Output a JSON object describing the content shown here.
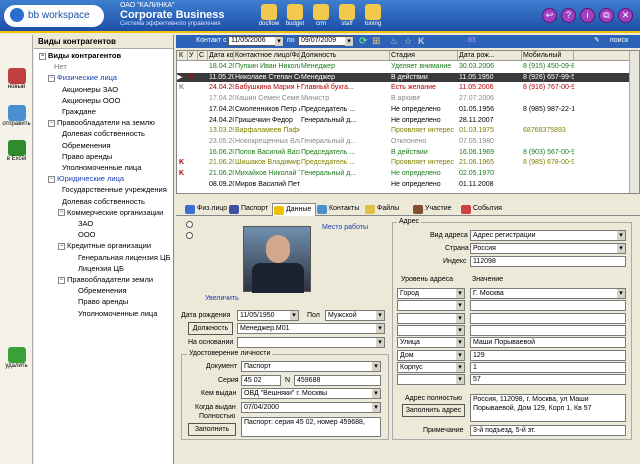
{
  "header": {
    "logo": "bb workspace",
    "company_small": "ОАО \"КАЛИНКА\"",
    "company": "Corporate Business",
    "subtitle": "Система эффективного управления",
    "toolbar": [
      {
        "label": "docflow",
        "icon": "docflow-icon"
      },
      {
        "label": "budget",
        "icon": "budget-icon"
      },
      {
        "label": "crm",
        "icon": "crm-icon"
      },
      {
        "label": "staff",
        "icon": "staff-icon"
      },
      {
        "label": "tuning",
        "icon": "tuning-icon"
      }
    ],
    "window_buttons": [
      "↩",
      "?",
      "i",
      "⧉",
      "✕"
    ]
  },
  "left_bar": [
    {
      "label": "новый",
      "icon": "new-icon"
    },
    {
      "label": "отправить",
      "icon": "send-icon"
    },
    {
      "label": "в Excel",
      "icon": "excel-icon"
    },
    {
      "label": "удалить",
      "icon": "delete-icon"
    }
  ],
  "tree": {
    "title": "Виды контрагентов",
    "nodes": [
      {
        "t": "Виды контрагентов",
        "s": "b"
      },
      {
        "t": "Нет",
        "s": "g"
      },
      {
        "t": "Физические лица",
        "s": "bl"
      },
      {
        "t": "Акционеры ЗАО",
        "s": ""
      },
      {
        "t": "Акционеры ООО",
        "s": ""
      },
      {
        "t": "Граждане",
        "s": ""
      },
      {
        "t": "Правообладатели на землю",
        "s": ""
      },
      {
        "t": "Долевая собственность",
        "s": ""
      },
      {
        "t": "Обременения",
        "s": ""
      },
      {
        "t": "Право аренды",
        "s": ""
      },
      {
        "t": "Уполномоченные лица",
        "s": ""
      },
      {
        "t": "Юридические лица",
        "s": "bl"
      },
      {
        "t": "Государственные учреждения",
        "s": ""
      },
      {
        "t": "Долевая собственность",
        "s": ""
      },
      {
        "t": "Коммерческие организации",
        "s": ""
      },
      {
        "t": "ЗАО",
        "s": ""
      },
      {
        "t": "ООО",
        "s": ""
      },
      {
        "t": "Кредитные организации",
        "s": ""
      },
      {
        "t": "Генеральная лицензия ЦБ",
        "s": ""
      },
      {
        "t": "Лицензия ЦБ",
        "s": ""
      },
      {
        "t": "Правообладатели земли",
        "s": ""
      },
      {
        "t": "Обременения",
        "s": ""
      },
      {
        "t": "Право аренды",
        "s": ""
      },
      {
        "t": "Уполномоченные лица",
        "s": ""
      }
    ]
  },
  "filter": {
    "contact_label": "Контакт с",
    "date_from": "11/05/2006",
    "to_label": "по",
    "date_to": "09/07/2009",
    "count": "83",
    "search": "поиск"
  },
  "grid": {
    "columns": [
      "К",
      "У",
      "С",
      "Дата конт...",
      "Контактное лицо/Фамилия ...",
      "Должность",
      "Стадия",
      "Дата рож...",
      "Мобильный"
    ],
    "rows": [
      {
        "k": "",
        "date": "18.04.2008",
        "name": "Пупкин Иван Николаевич",
        "pos": "Менеджер",
        "stage": "Уделяет внимание",
        "bd": "30.03.2006",
        "mob": "8 (915) 450-09-88",
        "c": "#1a7a1a"
      },
      {
        "k": "K",
        "date": "11.05.2006",
        "name": "Николаев Степан Семенович",
        "pos": "Менеджер",
        "stage": "В действии",
        "bd": "11.05.1950",
        "mob": "8 (926) 657-99-56",
        "c": "#fff",
        "sel": "1"
      },
      {
        "k": "K",
        "date": "24.04.2008",
        "name": "Бабушкина Мария Николаевна",
        "pos": "Главный бухга...",
        "stage": "Есть желание",
        "bd": "11.05.2006",
        "mob": "8 (916) 767-00-99",
        "c": "#b00000"
      },
      {
        "k": "",
        "date": "17.04.2008",
        "name": "Кашин Семен Семенович",
        "pos": "Министр",
        "stage": "В архиве",
        "bd": "27.07.2006",
        "mob": "",
        "c": "#888"
      },
      {
        "k": "",
        "date": "17.04.2008",
        "name": "Смоленников Петр Андреевич",
        "pos": "Председатель ...",
        "stage": "Не определено",
        "bd": "01.05.1956",
        "mob": "8 (985) 987-22-11",
        "c": "#000"
      },
      {
        "k": "",
        "date": "24.04.2008",
        "name": "Гришечкин Федор",
        "pos": "Генеральный д...",
        "stage": "Не определено",
        "bd": "28.11.2007",
        "mob": "",
        "c": "#000"
      },
      {
        "k": "",
        "date": "13.03.2008",
        "name": "Варфаламеев Пафнутий Евл...",
        "pos": "",
        "stage": "Проявляет интерес",
        "bd": "01.03.1975",
        "mob": "68768375893",
        "c": "#808000"
      },
      {
        "k": "",
        "date": "23.05.2008",
        "name": "Новокрещенных Владисл...",
        "pos": "Генеральный д...",
        "stage": "Отклонено",
        "bd": "07.05.1980",
        "mob": "",
        "c": "#888"
      },
      {
        "k": "",
        "date": "16.06.2008",
        "name": "Попов Василий Васильевич",
        "pos": "Председатель ...",
        "stage": "В действии",
        "bd": "16.06.1969",
        "mob": "8 (903) 567-00-99",
        "c": "#1a7a1a"
      },
      {
        "k": "K",
        "date": "21.06.2008",
        "name": "Шишаков Владимир Геннад...",
        "pos": "Председатель ...",
        "stage": "Проявляет интерес",
        "bd": "21.06.1965",
        "mob": "8 (985) 678-00-98",
        "c": "#808000"
      },
      {
        "k": "K",
        "date": "21.06.2008",
        "name": "Михайков Николай Терентье...",
        "pos": "Генеральный д...",
        "stage": "Не определено",
        "bd": "02.05.1970",
        "mob": "",
        "c": "#1a7a1a"
      },
      {
        "k": "",
        "date": "08.09.2008",
        "name": "Миров Василий Петрович",
        "pos": "",
        "stage": "Не определено",
        "bd": "01.11.2008",
        "mob": "",
        "c": "#000"
      }
    ]
  },
  "tabs": [
    {
      "label": "Физ.лицо",
      "c": "#3a6fd0"
    },
    {
      "label": "Паспорт",
      "c": "#4050a0"
    },
    {
      "label": "Данные",
      "c": "#f0c000"
    },
    {
      "label": "Контакты",
      "c": "#4a90d0"
    },
    {
      "label": "Файлы",
      "c": "#e0c040"
    },
    {
      "label": "Участие",
      "c": "#805030"
    },
    {
      "label": "События",
      "c": "#d04040"
    }
  ],
  "person": {
    "work_place": "Место работы",
    "enlarge": "Увеличить",
    "birth_label": "Дата рождения",
    "birth": "11/05/1950",
    "sex_label": "Пол",
    "sex": "Мужской",
    "position_btn": "Должность",
    "position": "Менеджер.М01",
    "basis_label": "На основании",
    "basis": ""
  },
  "id_doc": {
    "title": "Удостоверение личности",
    "doc_label": "Документ",
    "doc": "Паспорт",
    "series_label": "Серия",
    "series": "45 02",
    "n_label": "N",
    "number": "459688",
    "issuer_label": "Кем выдан",
    "issuer": "ОВД \"Вешняки\" г. Москвы",
    "issued_label": "Когда выдан",
    "issued": "07/04/2000",
    "full_label": "Полностью",
    "fill_btn": "Заполнить",
    "full": "Паспорт: серия 45 02, номер 459688,"
  },
  "address": {
    "title": "Адрес",
    "kind_label": "Вид адреса",
    "kind": "Адрес регистрации",
    "country_label": "Страна",
    "country": "Россия",
    "index_label": "Индекс",
    "index": "112098",
    "level_label": "Уровень адреса",
    "value_label": "Значение",
    "levels": [
      {
        "l": "Город",
        "v": "Г. Москва"
      },
      {
        "l": "",
        "v": ""
      },
      {
        "l": "",
        "v": ""
      },
      {
        "l": "",
        "v": ""
      },
      {
        "l": "Улица",
        "v": "Маши Порываевой"
      },
      {
        "l": "Дом",
        "v": "129"
      },
      {
        "l": "Корпус",
        "v": "1"
      },
      {
        "l": "",
        "v": "57"
      }
    ],
    "full_label": "Адрес полностью",
    "fill_btn": "Заполнить адрес",
    "full": "Россия, 112098, г. Москва, ул Маши Порываевой, Дом 129, Корп 1, Кв 57",
    "note_label": "Примечание",
    "note": "3-й подъезд, 5-й эт."
  }
}
